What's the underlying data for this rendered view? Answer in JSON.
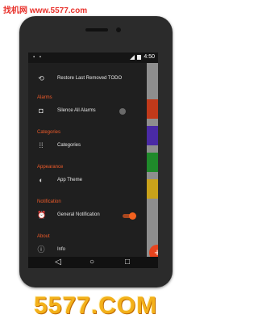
{
  "watermark": {
    "top": "找机网 www.5577.com",
    "bottom": "5577.COM"
  },
  "statusbar": {
    "time": "4:50"
  },
  "drawer": {
    "top_item": {
      "label": "Restore Last Removed TODO",
      "icon": "history-icon"
    },
    "sections": [
      {
        "title": "Alarms",
        "item": {
          "label": "Silence All Alarms",
          "icon": "vibrate-icon",
          "toggle": "off"
        }
      },
      {
        "title": "Categories",
        "item": {
          "label": "Categories",
          "icon": "grid-icon"
        }
      },
      {
        "title": "Appearance",
        "item": {
          "label": "App Theme",
          "icon": "contrast-icon"
        }
      },
      {
        "title": "Notification",
        "item": {
          "label": "General Notification",
          "icon": "alarm-bell-icon",
          "toggle": "on"
        }
      },
      {
        "title": "About",
        "item": {
          "label": "Info",
          "icon": "info-icon"
        }
      }
    ]
  },
  "fab": {
    "label": "+"
  },
  "navbar": {
    "back": "◁",
    "home": "○",
    "recents": "□"
  },
  "colors": {
    "accent": "#ef5b2a",
    "drawer_bg": "#1f1f1f",
    "tiles": [
      "#c0391a",
      "#4a2aa5",
      "#1f8a2a",
      "#c9a21a"
    ]
  }
}
